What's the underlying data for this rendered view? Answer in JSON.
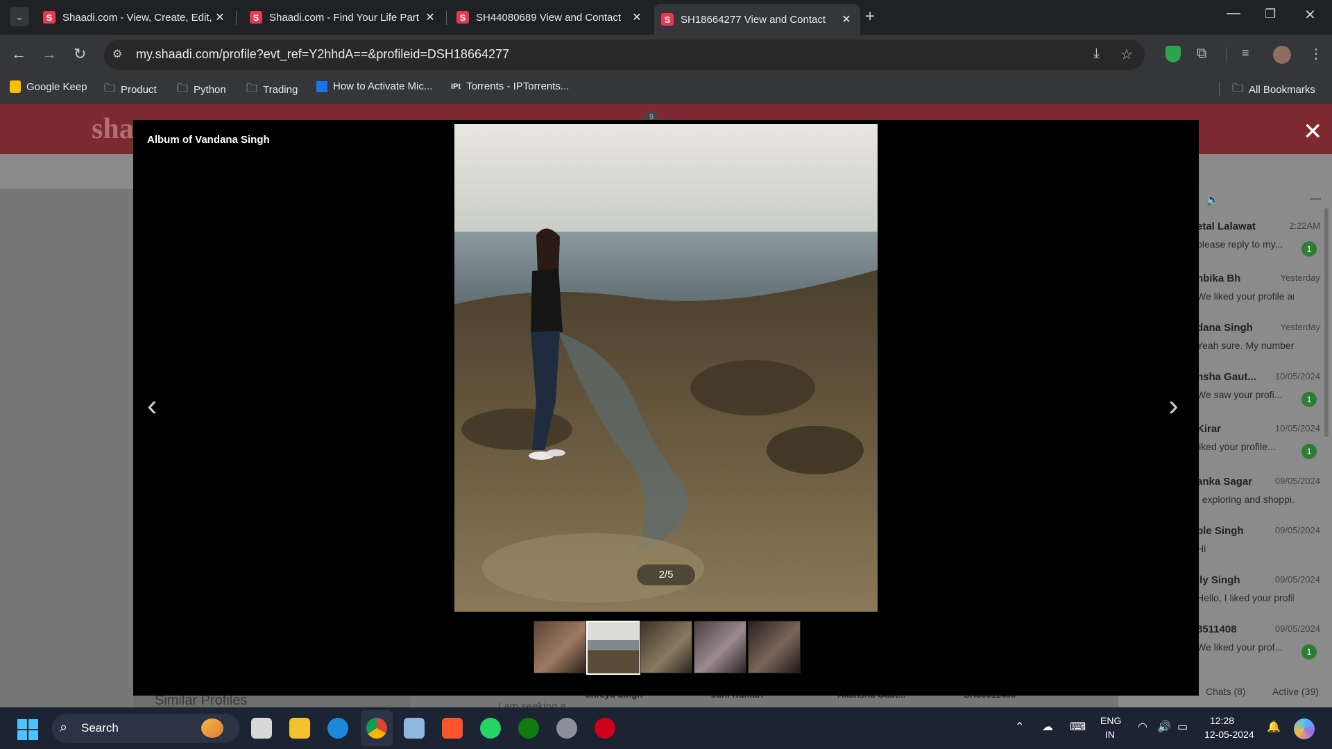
{
  "browser": {
    "tabs": [
      {
        "title": "Shaadi.com - View, Create, Edit, ",
        "active": false
      },
      {
        "title": "Shaadi.com - Find Your Life Part",
        "active": false
      },
      {
        "title": "SH44080689 View and Contact",
        "active": false
      },
      {
        "title": "SH18664277 View and Contact",
        "active": true
      }
    ],
    "url": "my.shaadi.com/profile?evt_ref=Y2hhdA==&profileid=DSH18664277",
    "bookmarks": [
      "Google Keep",
      "Product",
      "Python",
      "Trading",
      "How to Activate Mic...",
      "Torrents - IPTorrents..."
    ],
    "all_bookmarks": "All Bookmarks"
  },
  "page": {
    "logo_partial": "sha",
    "header_badge": "9",
    "similar_profiles": "Similar Profiles",
    "seeking_text": "I am seeking a",
    "bottom_names": [
      "Shreya Singh",
      "Juhi Kumari",
      "Akansha Gaut...",
      "SH30511408"
    ],
    "chat_footer": {
      "chats": "Chats (8)",
      "active": "Active (39)"
    },
    "chats": [
      {
        "name": "etal Lalawat",
        "date": "2:22AM",
        "msg": "please reply to my...",
        "count": "1"
      },
      {
        "name": "nbika Bh",
        "date": "Yesterday",
        "msg": "We liked your profile an...",
        "count": ""
      },
      {
        "name": "dana Singh",
        "date": "Yesterday",
        "msg": "Yeah sure. My number i...",
        "count": ""
      },
      {
        "name": "nsha Gaut...",
        "date": "10/05/2024",
        "msg": "We saw your profi...",
        "count": "1"
      },
      {
        "name": "Kirar",
        "date": "10/05/2024",
        "msg": "liked your profile...",
        "count": "1"
      },
      {
        "name": "anka Sagar",
        "date": "09/05/2024",
        "msg": ". exploring and shoppi...",
        "count": ""
      },
      {
        "name": "ple Singh",
        "date": "09/05/2024",
        "msg": "Hi",
        "count": ""
      },
      {
        "name": "ily Singh",
        "date": "09/05/2024",
        "msg": "Hello, I liked your profil...",
        "count": ""
      },
      {
        "name": "8511408",
        "date": "09/05/2024",
        "msg": "We liked your prof...",
        "count": "1"
      }
    ]
  },
  "modal": {
    "album_title": "Album of Vandana Singh",
    "counter": "2/5",
    "current_index": 2,
    "total": 5
  },
  "taskbar": {
    "search_label": "Search",
    "lang_top": "ENG",
    "lang_bottom": "IN",
    "time": "12:28",
    "date": "12-05-2024"
  },
  "colors": {
    "chrome_bg": "#202124",
    "toolbar_bg": "#35363a",
    "modal_bg": "#000000",
    "brand": "#e63950",
    "taskbar_bg": "#1c2333"
  }
}
